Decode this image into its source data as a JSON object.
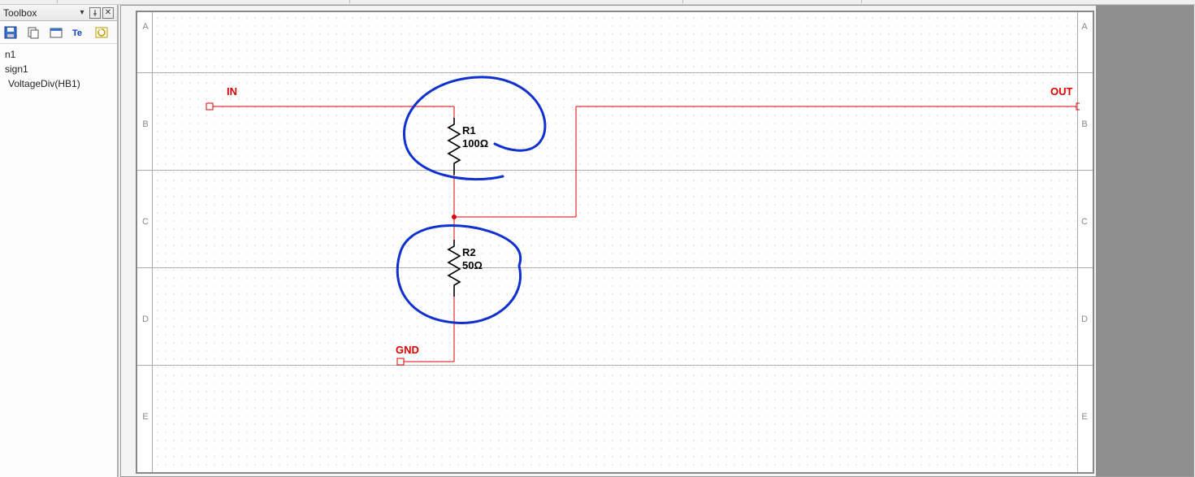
{
  "toolbox": {
    "title": "Toolbox",
    "tree": {
      "item0": "n1",
      "item1": "sign1",
      "item2": "VoltageDiv(HB1)"
    }
  },
  "rows": {
    "A": "A",
    "B": "B",
    "C": "C",
    "D": "D",
    "E": "E"
  },
  "schematic": {
    "ports": {
      "in": {
        "label": "IN"
      },
      "out": {
        "label": "OUT"
      },
      "gnd": {
        "label": "GND"
      }
    },
    "components": {
      "r1": {
        "name": "R1",
        "value": "100Ω"
      },
      "r2": {
        "name": "R2",
        "value": "50Ω"
      }
    },
    "nets_color": "#dd0000",
    "annotation_color": "#1030d0"
  }
}
